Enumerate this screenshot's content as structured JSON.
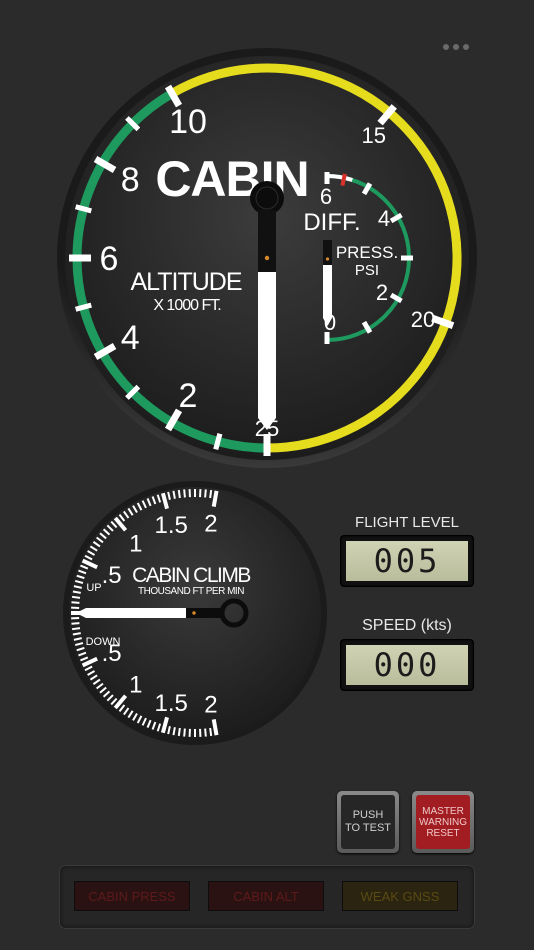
{
  "menu": {
    "icon": "more-dots-icon"
  },
  "cabin_gauge": {
    "title": "CABIN",
    "subtitle": "ALTITUDE",
    "unit": "X 1000 FT.",
    "scale_labels": [
      "2",
      "4",
      "6",
      "8",
      "10",
      "15",
      "20",
      "25"
    ],
    "diff_title": "DIFF.",
    "diff_unit_1": "PRESS.",
    "diff_unit_2": "PSI",
    "diff_labels": [
      "0",
      "2",
      "4",
      "6"
    ],
    "altitude_value": 0,
    "diff_value": 0,
    "colors": {
      "green": "#1e9a5e",
      "yellow": "#e6dc1e",
      "red": "#d8322a"
    }
  },
  "climb_gauge": {
    "title": "CABIN CLIMB",
    "unit": "THOUSAND FT PER MIN",
    "up_label": "UP",
    "down_label": "DOWN",
    "upper_labels": [
      ".5",
      "1",
      "1.5",
      "2"
    ],
    "lower_labels": [
      ".5",
      "1",
      "1.5",
      "2"
    ],
    "climb_value": 0
  },
  "flight_level": {
    "label": "FLIGHT LEVEL",
    "value": "005"
  },
  "speed": {
    "label": "SPEED (kts)",
    "value": "000"
  },
  "buttons": {
    "test": "PUSH\nTO TEST",
    "master": "MASTER\nWARNING\nRESET"
  },
  "annunciators": [
    {
      "label": "CABIN PRESS",
      "color": "#5e1a1a",
      "bg": "#2a1212"
    },
    {
      "label": "CABIN ALT",
      "color": "#5e1a1a",
      "bg": "#2a1212"
    },
    {
      "label": "WEAK GNSS",
      "color": "#5a4a12",
      "bg": "#2a2410"
    }
  ]
}
